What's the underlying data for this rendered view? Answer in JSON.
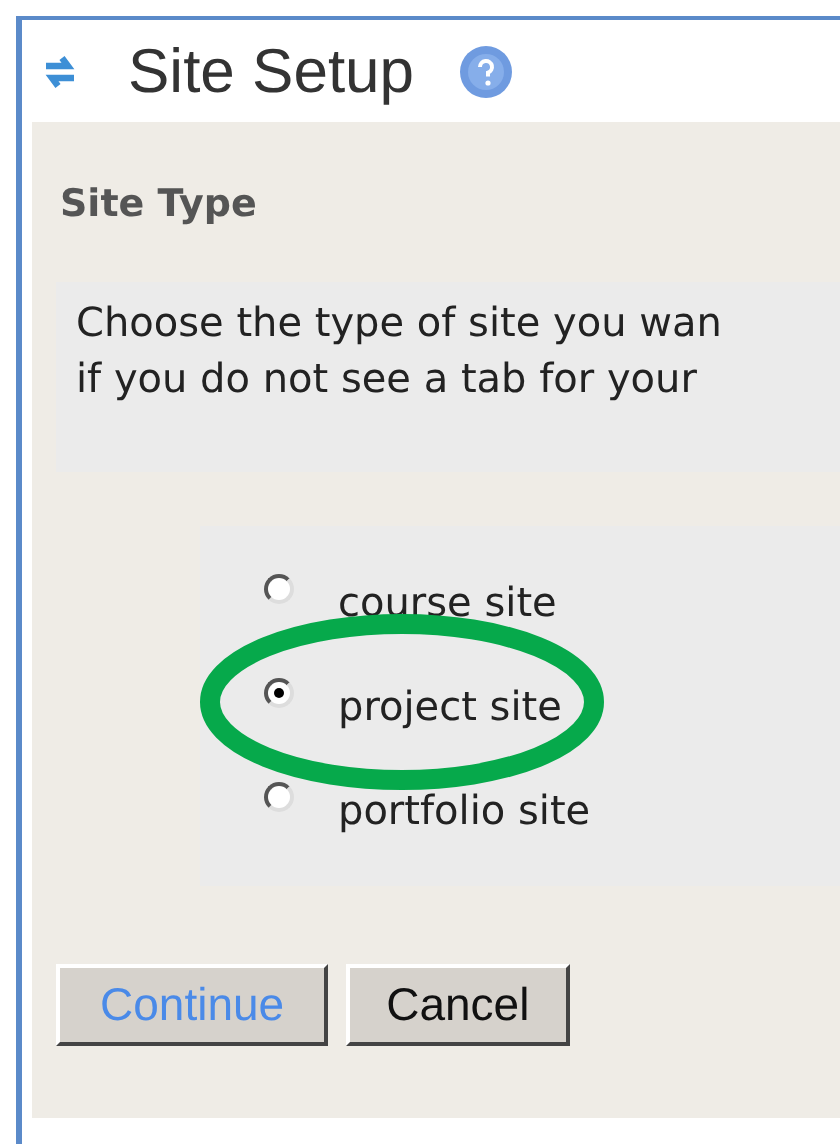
{
  "window": {
    "title": "Site Setup"
  },
  "section": {
    "heading": "Site Type",
    "instructions": [
      "Choose the type of site you wan",
      "if you do not see a tab for your"
    ]
  },
  "site_types": [
    {
      "label": "course site",
      "selected": false,
      "circled": false
    },
    {
      "label": "project site",
      "selected": true,
      "circled": true
    },
    {
      "label": "portfolio site",
      "selected": false,
      "circled": false
    }
  ],
  "buttons": [
    {
      "label": "Continue",
      "kind": "primary"
    },
    {
      "label": "Cancel",
      "kind": "normal"
    }
  ]
}
